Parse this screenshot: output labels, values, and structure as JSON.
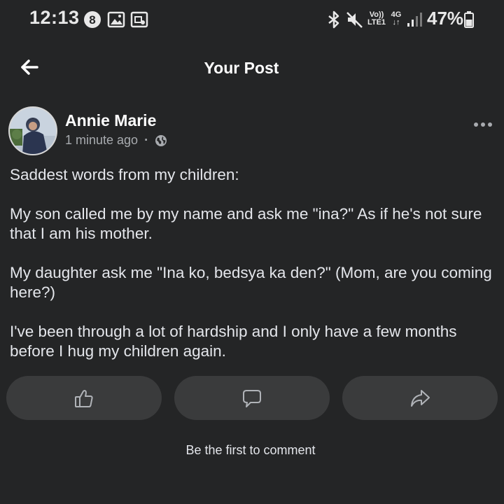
{
  "status_bar": {
    "time": "12:13",
    "network_volte": "Vo))",
    "network_lte": "LTE1",
    "network_4g": "4G",
    "battery": "47%",
    "icons": [
      "notification-badge-icon",
      "gallery-icon",
      "screenshot-icon",
      "bluetooth-icon",
      "mute-icon",
      "signal-icon",
      "battery-icon"
    ]
  },
  "header": {
    "title": "Your Post",
    "back_icon": "back-arrow-icon"
  },
  "post": {
    "author": "Annie Marie",
    "time": "1 minute ago",
    "separator": "·",
    "privacy_icon": "globe-icon",
    "paragraphs": [
      "Saddest words from my children:",
      "My son called me by my name and ask me \"ina?\" As if he's not sure that I am his mother.",
      "My daughter ask me \"Ina ko, bedsya ka den?\" (Mom, are you coming here?)",
      "I've been through a lot of hardship and I only have a few months before I hug my children again."
    ]
  },
  "actions": {
    "like_icon": "thumbs-up-icon",
    "comment_icon": "comment-icon",
    "share_icon": "share-icon"
  },
  "comments": {
    "empty_text": "Be the first to comment"
  },
  "colors": {
    "background": "#242526",
    "button_bg": "#3a3b3c",
    "secondary_text": "#a8abaf"
  }
}
